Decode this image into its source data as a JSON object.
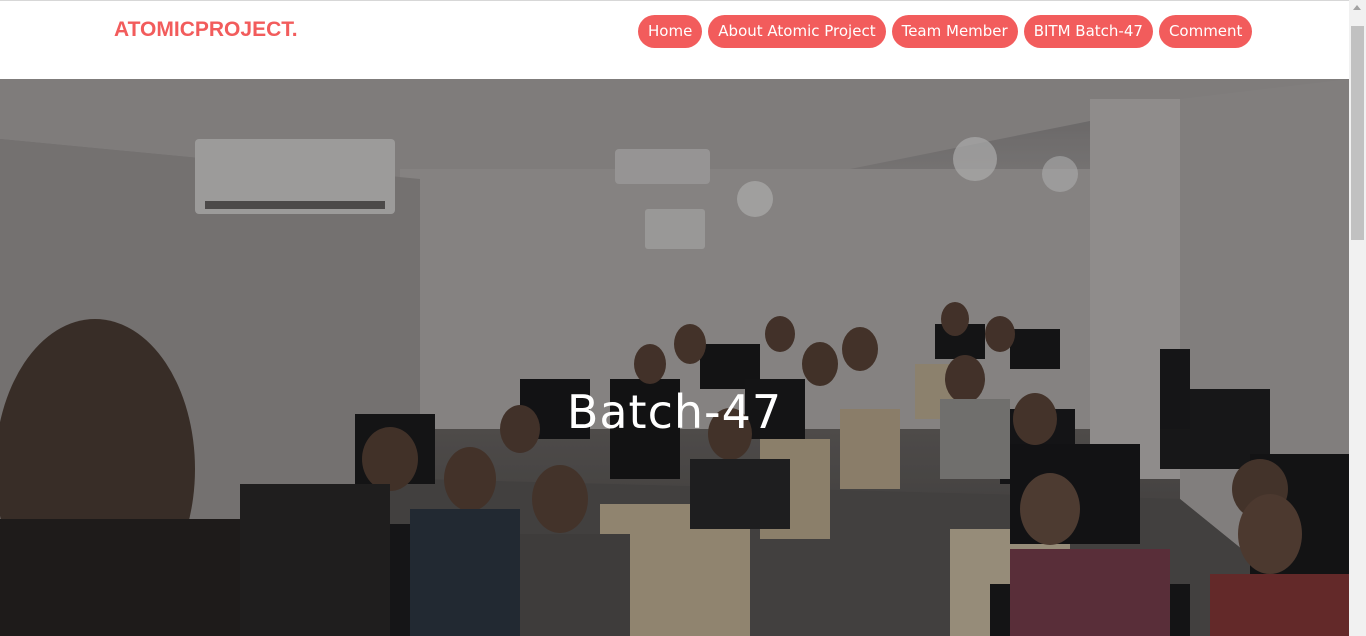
{
  "brand": {
    "name": "ATOMICPROJECT."
  },
  "nav": {
    "items": [
      {
        "label": "Home"
      },
      {
        "label": "About Atomic Project"
      },
      {
        "label": "Team Member"
      },
      {
        "label": "BITM Batch-47"
      },
      {
        "label": "Comment"
      }
    ]
  },
  "hero": {
    "title": "Batch-47",
    "image": "classroom-group-photo"
  },
  "colors": {
    "accent": "#f25c5c",
    "nav_text": "#ffffff",
    "hero_text": "#ffffff"
  }
}
